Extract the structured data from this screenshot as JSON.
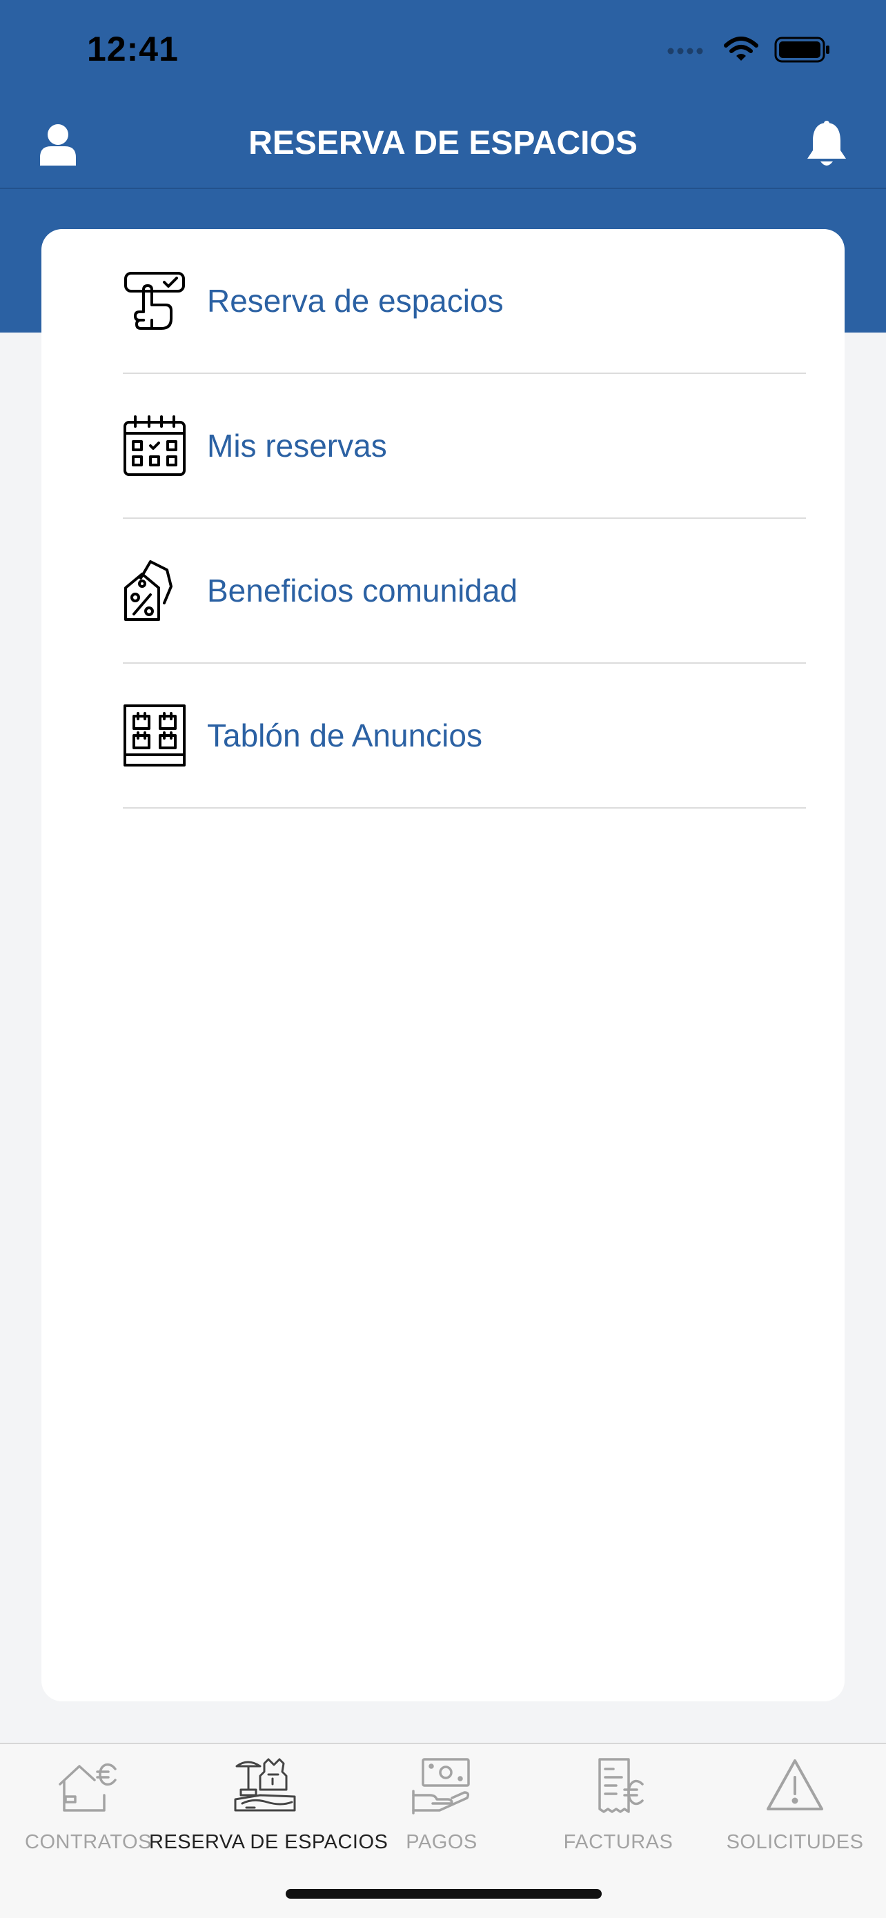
{
  "status_bar": {
    "time": "12:41"
  },
  "navbar": {
    "title": "RESERVA DE ESPACIOS",
    "left_icon": "user-icon",
    "right_icon": "bell-icon"
  },
  "menu": {
    "items": [
      {
        "label": "Reserva de espacios",
        "icon": "touch-check-icon"
      },
      {
        "label": "Mis reservas",
        "icon": "calendar-icon"
      },
      {
        "label": "Beneficios comunidad",
        "icon": "discount-tag-icon"
      },
      {
        "label": "Tablón de Anuncios",
        "icon": "notice-board-icon"
      }
    ]
  },
  "tabbar": {
    "tabs": [
      {
        "label": "CONTRATOS",
        "icon": "house-euro-icon",
        "active": false
      },
      {
        "label": "RESERVA DE ESPACIOS",
        "icon": "facilities-icon",
        "active": true
      },
      {
        "label": "PAGOS",
        "icon": "hand-money-icon",
        "active": false
      },
      {
        "label": "FACTURAS",
        "icon": "receipt-euro-icon",
        "active": false
      },
      {
        "label": "SOLICITUDES",
        "icon": "warning-icon",
        "active": false
      }
    ]
  },
  "colors": {
    "header_blue": "#2b61a3",
    "link_blue": "#2b61a3",
    "tab_inactive": "#a3a3a3",
    "tab_active": "#222222"
  }
}
